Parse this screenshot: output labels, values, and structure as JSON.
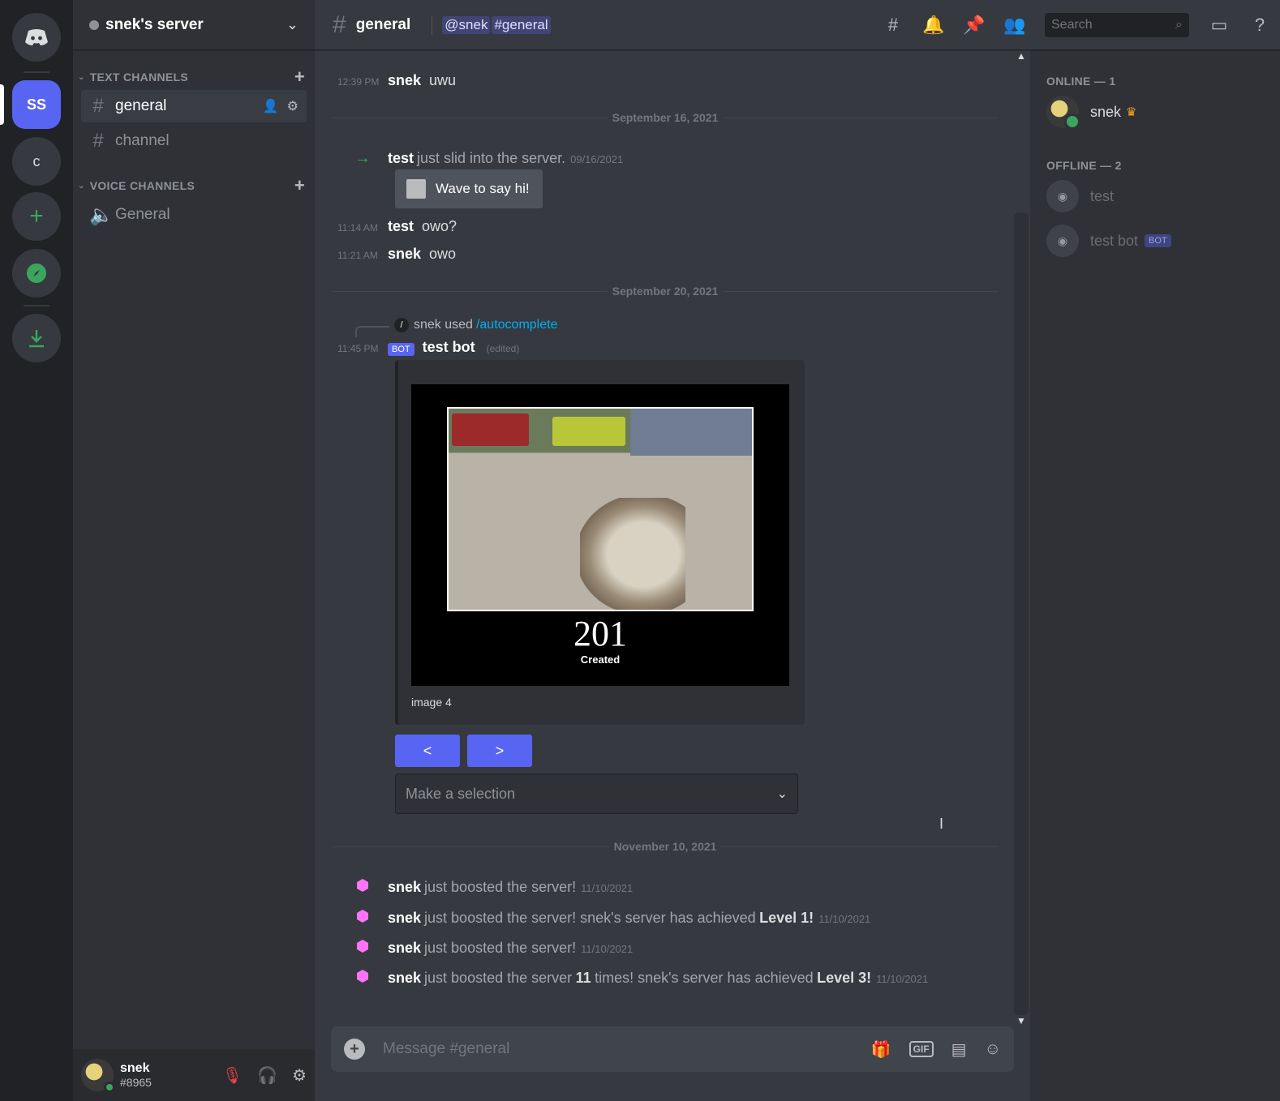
{
  "server": {
    "name": "snek's server",
    "rail": [
      {
        "name": "home",
        "label": ""
      },
      {
        "name": "ss",
        "label": "SS"
      },
      {
        "name": "c",
        "label": "c"
      }
    ]
  },
  "sidebar": {
    "text_category": "TEXT CHANNELS",
    "voice_category": "VOICE CHANNELS",
    "text_channels": [
      "general",
      "channel"
    ],
    "voice_channels": [
      "General"
    ]
  },
  "user": {
    "name": "snek",
    "tag": "#8965"
  },
  "header": {
    "channel": "general",
    "topic_mention_user": "@snek",
    "topic_mention_channel": "#general",
    "search_placeholder": "Search"
  },
  "messages": {
    "m1": {
      "time": "12:39 PM",
      "author": "snek",
      "text": "uwu"
    },
    "day1": "September 16, 2021",
    "join": {
      "author": "test",
      "text": "just slid into the server.",
      "date": "09/16/2021",
      "wave": "Wave to say hi!"
    },
    "m2": {
      "time": "11:14 AM",
      "author": "test",
      "text": "owo?"
    },
    "m3": {
      "time": "11:21 AM",
      "author": "snek",
      "text": "owo"
    },
    "day2": "September 20, 2021",
    "reply": {
      "user": "snek",
      "verb": "used",
      "command": "/autocomplete"
    },
    "bot": {
      "time": "11:45 PM",
      "badge": "BOT",
      "author": "test bot",
      "edited": "(edited)"
    },
    "embed": {
      "code": "201",
      "code_label": "Created",
      "footer": "image 4"
    },
    "prev_label": "<",
    "next_label": ">",
    "select_placeholder": "Make a selection",
    "day3": "November 10, 2021",
    "boosts": [
      {
        "author": "snek",
        "text": "just boosted the server!",
        "extra": "",
        "level": "",
        "date": "11/10/2021"
      },
      {
        "author": "snek",
        "text": "just boosted the server! snek's server has achieved",
        "extra": "",
        "level": "Level 1!",
        "date": "11/10/2021"
      },
      {
        "author": "snek",
        "text": "just boosted the server!",
        "extra": "",
        "level": "",
        "date": "11/10/2021"
      },
      {
        "author": "snek",
        "text": "just boosted the server",
        "extra": "11",
        "text2": "times! snek's server has achieved",
        "level": "Level 3!",
        "date": "11/10/2021"
      }
    ]
  },
  "composer": {
    "placeholder": "Message #general",
    "gif_label": "GIF"
  },
  "members": {
    "online_header": "ONLINE — 1",
    "offline_header": "OFFLINE — 2",
    "online": [
      {
        "name": "snek"
      }
    ],
    "offline": [
      {
        "name": "test",
        "badge": ""
      },
      {
        "name": "test bot",
        "badge": "BOT"
      }
    ]
  },
  "colors": {
    "accent": "#5865f2",
    "online": "#3ba55d",
    "boost": "#ff73fa",
    "link": "#00aff4"
  }
}
